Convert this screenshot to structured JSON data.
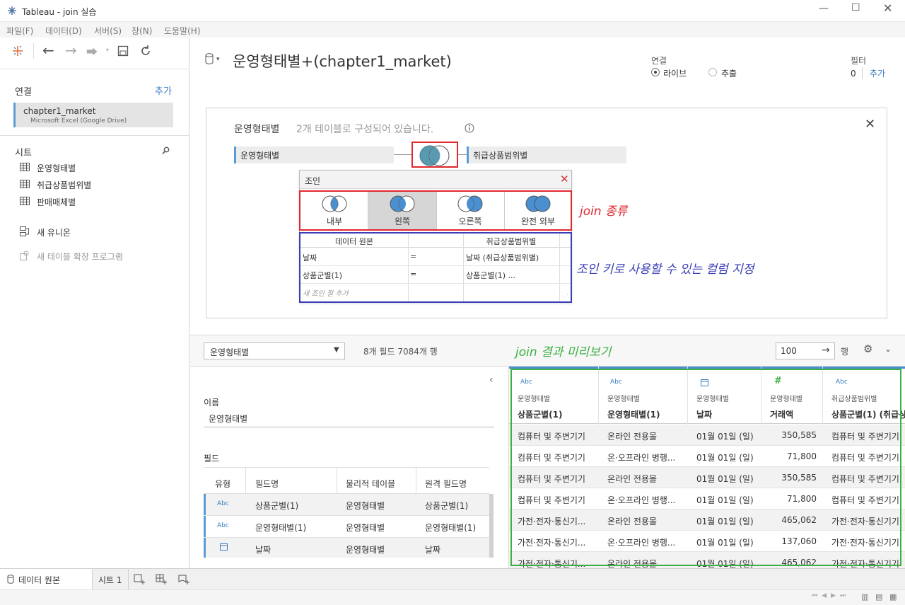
{
  "window": {
    "title": "Tableau - join 실습"
  },
  "menu": [
    "파일(F)",
    "데이터(D)",
    "서버(S)",
    "창(N)",
    "도움말(H)"
  ],
  "left": {
    "connections_label": "연결",
    "add_label": "추가",
    "connection": {
      "name": "chapter1_market",
      "sub": "Microsoft Excel (Google Drive)"
    },
    "sheets_label": "시트",
    "sheets": [
      "운영형태별",
      "취급상품범위별",
      "판매매체별"
    ],
    "new_union": "새 유니온",
    "new_extension": "새 테이블 확장 프로그램"
  },
  "header": {
    "datasource_title": "운영형태별+(chapter1_market)",
    "connection_label": "연결",
    "live_label": "라이브",
    "extract_label": "추출",
    "filter_label": "필터",
    "filter_count": "0",
    "filter_add": "추가"
  },
  "canvas": {
    "table_name": "운영형태별",
    "desc": "2개 테이블로 구성되어 있습니다.",
    "left_table": "운영형태별",
    "right_table": "취급상품범위별"
  },
  "join_dialog": {
    "title": "조인",
    "types": [
      "내부",
      "왼쪽",
      "오른쪽",
      "완전 외부"
    ],
    "selected_type": "왼쪽",
    "col_left": "데이터 원본",
    "col_right": "취급상품범위별",
    "clauses": [
      {
        "left": "날짜",
        "op": "=",
        "right": "날짜 (취급상품범위별)"
      },
      {
        "left": "상품군별(1)",
        "op": "=",
        "right": "상품군별(1) ..."
      }
    ],
    "add_clause": "새 조인 절 추가"
  },
  "annotations": {
    "join_type": "join 종류",
    "join_key": "조인 키로 사용할 수 있는 컬럼 지정",
    "preview": "join 결과 미리보기",
    "red": "#e0282e",
    "blue": "#3b3fb6",
    "green": "#3cb043"
  },
  "toolbar2": {
    "table_select": "운영형태별",
    "info": "8개 필드 7084개 행",
    "rows_value": "100",
    "rows_label": "행"
  },
  "meta": {
    "name_label": "이름",
    "name_value": "운영형태별",
    "fields_label": "필드",
    "columns": [
      "유형",
      "필드명",
      "물리적 테이블",
      "원격 필드명"
    ],
    "rows": [
      {
        "type": "Abc",
        "name": "상품군별(1)",
        "table": "운영형태별",
        "remote": "상품군별(1)"
      },
      {
        "type": "Abc",
        "name": "운영형태별(1)",
        "table": "운영형태별",
        "remote": "운영형태별(1)"
      },
      {
        "type": "calendar-icon",
        "name": "날짜",
        "table": "운영형태별",
        "remote": "날짜"
      }
    ]
  },
  "preview": {
    "columns": [
      {
        "icon": "Abc",
        "source": "운영형태별",
        "name": "상품군별(1)"
      },
      {
        "icon": "Abc",
        "source": "운영형태별",
        "name": "운영형태별(1)"
      },
      {
        "icon": "calendar",
        "source": "운영형태별",
        "name": "날짜"
      },
      {
        "icon": "#",
        "source": "운영형태별",
        "name": "거래액"
      },
      {
        "icon": "Abc",
        "source": "취급상품범위별",
        "name": "상품군별(1) (취급상"
      }
    ],
    "rows": [
      [
        "컴퓨터 및 주변기기",
        "온라인 전용몰",
        "01월 01일 (일)",
        "350,585",
        "컴퓨터 및 주변기기"
      ],
      [
        "컴퓨터 및 주변기기",
        "온·오프라인 병행...",
        "01월 01일 (일)",
        "71,800",
        "컴퓨터 및 주변기기"
      ],
      [
        "컴퓨터 및 주변기기",
        "온라인 전용몰",
        "01월 01일 (일)",
        "350,585",
        "컴퓨터 및 주변기기"
      ],
      [
        "컴퓨터 및 주변기기",
        "온·오프라인 병행...",
        "01월 01일 (일)",
        "71,800",
        "컴퓨터 및 주변기기"
      ],
      [
        "가전·전자·통신기...",
        "온라인 전용몰",
        "01월 01일 (일)",
        "465,062",
        "가전·전자·통신기기"
      ],
      [
        "가전·전자·통신기...",
        "온·오프라인 병행...",
        "01월 01일 (일)",
        "137,060",
        "가전·전자·통신기기"
      ],
      [
        "가전·전자·통신기...",
        "온라인 전용몰",
        "01월 01일 (일)",
        "465,062",
        "가전·전자·통신기기"
      ]
    ]
  },
  "tabs": {
    "datasource": "데이터 원본",
    "sheet1": "시트 1"
  }
}
